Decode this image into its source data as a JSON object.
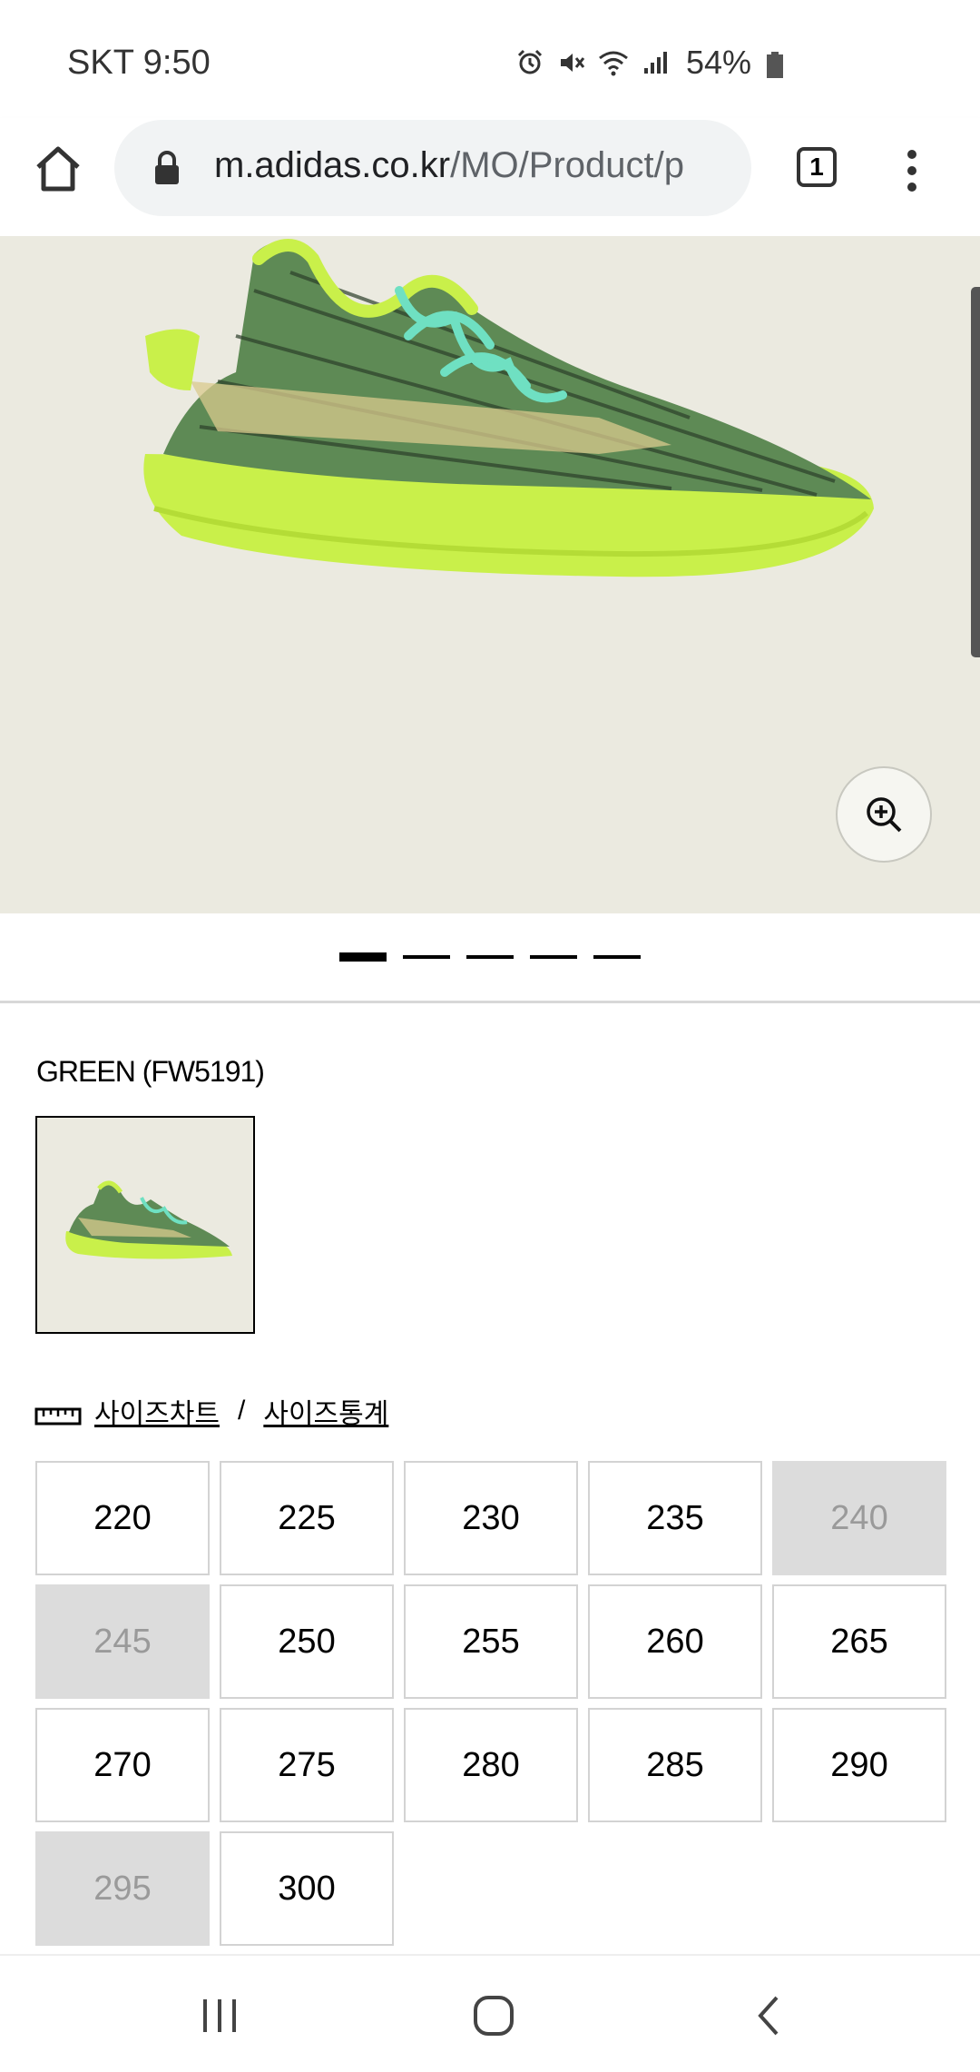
{
  "status_bar": {
    "carrier": "SKT",
    "time": "9:50",
    "battery": "54%"
  },
  "browser": {
    "url_domain": "m.adidas.co.kr",
    "url_path": "/MO/Product/p",
    "tab_count": "1"
  },
  "product": {
    "color_label": "GREEN (FW5191)",
    "image_count": 5,
    "active_image": 1
  },
  "size_links": {
    "size_chart": "사이즈차트",
    "separator": "/",
    "size_stats": "사이즈통계"
  },
  "sizes": [
    {
      "label": "220",
      "available": true
    },
    {
      "label": "225",
      "available": true
    },
    {
      "label": "230",
      "available": true
    },
    {
      "label": "235",
      "available": true
    },
    {
      "label": "240",
      "available": false
    },
    {
      "label": "245",
      "available": false
    },
    {
      "label": "250",
      "available": true
    },
    {
      "label": "255",
      "available": true
    },
    {
      "label": "260",
      "available": true
    },
    {
      "label": "265",
      "available": true
    },
    {
      "label": "270",
      "available": true
    },
    {
      "label": "275",
      "available": true
    },
    {
      "label": "280",
      "available": true
    },
    {
      "label": "285",
      "available": true
    },
    {
      "label": "290",
      "available": true
    },
    {
      "label": "295",
      "available": false
    },
    {
      "label": "300",
      "available": true
    }
  ],
  "colors": {
    "hero_bg": "#ebeae0",
    "shoe_sole": "#c9f04a",
    "shoe_upper": "#5e8a55",
    "laces": "#6fe0c2",
    "disabled_cell": "#dcdcdc"
  }
}
